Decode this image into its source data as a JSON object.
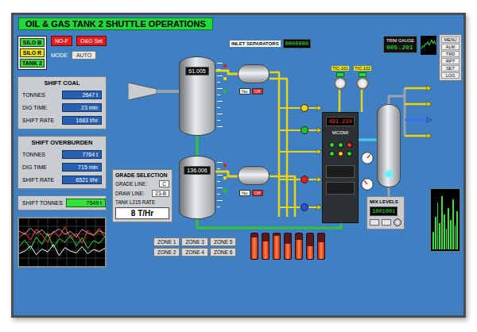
{
  "title": "OIL & GAS TANK 2 SHUTTLE OPERATIONS",
  "legend": [
    {
      "label": "SILO B",
      "color": "#39d839"
    },
    {
      "label": "SILO R",
      "color": "#f2e600"
    },
    {
      "label": "TANK 2",
      "color": "#39d839"
    }
  ],
  "buttons": [
    {
      "label": "NO-F"
    },
    {
      "label": "O&G Set"
    }
  ],
  "mode": {
    "label": "MODE",
    "value": "AUTO"
  },
  "panels": [
    {
      "title": "SHIFT COAL",
      "rows": [
        {
          "label": "TONNES",
          "value": "2647 t"
        },
        {
          "label": "DIG TIME",
          "value": "23 min"
        },
        {
          "label": "SHIFT RATE",
          "value": "1683 t/hr"
        }
      ]
    },
    {
      "title": "SHIFT OVERBURDEN",
      "rows": [
        {
          "label": "TONNES",
          "value": "7764 t"
        },
        {
          "label": "DIG TIME",
          "value": "715 min"
        },
        {
          "label": "SHIFT RATE",
          "value": "6521 t/hr"
        }
      ]
    }
  ],
  "shift_tonnes": {
    "label": "SHIFT TONNES",
    "value": "7549 t"
  },
  "trend": {
    "series": [
      {
        "color": "#ff3b3b",
        "values": [
          60,
          72,
          55,
          80,
          66,
          50,
          75,
          62,
          85,
          58,
          70,
          48,
          77,
          64,
          82,
          60
        ]
      },
      {
        "color": "#39e039",
        "values": [
          40,
          55,
          35,
          62,
          45,
          70,
          38,
          58,
          50,
          66,
          42,
          60,
          36,
          54,
          47,
          63
        ]
      },
      {
        "color": "#ffffff",
        "values": [
          25,
          30,
          42,
          22,
          35,
          28,
          45,
          20,
          38,
          30,
          26,
          40,
          24,
          34,
          29,
          37
        ]
      },
      {
        "color": "#f0a0a0",
        "values": [
          75,
          68,
          82,
          70,
          78,
          65,
          72,
          80,
          68,
          74,
          62,
          79,
          71,
          66,
          76,
          70
        ]
      }
    ]
  },
  "grade": {
    "title": "GRADE SELECTION",
    "rows": [
      {
        "label": "GRADE LINE:",
        "value": "C"
      },
      {
        "label": "DRAW LINE:",
        "value": "23-B"
      }
    ],
    "rate_label": "TANK L215 RATE",
    "rate": "8 T/Hr"
  },
  "zones": [
    "ZONE 1",
    "ZONE 2",
    "ZONE 3",
    "ZONE 4",
    "ZONE 5",
    "ZONE 6"
  ],
  "inlet": {
    "label": "INLET SEPARATORS",
    "display": "0000000"
  },
  "tanks": [
    {
      "reading": "61.005"
    },
    {
      "reading": "136.006"
    }
  ],
  "separators": [
    {
      "switches": [
        {
          "label": "No",
          "color": "#ffffff"
        },
        {
          "label": "Off",
          "color": "#e02020"
        }
      ]
    },
    {
      "switches": [
        {
          "label": "No",
          "color": "#ffffff"
        },
        {
          "label": "Off",
          "color": "#e02020"
        }
      ]
    }
  ],
  "valves": [
    {
      "color": "#f2d200"
    },
    {
      "color": "#22c322"
    },
    {
      "color": "#e02020"
    },
    {
      "color": "#2a4fe0"
    }
  ],
  "cabinet": {
    "readout": "491.234",
    "tag": "MCDMI",
    "lights": [
      {
        "color": "#33dd33"
      },
      {
        "color": "#33dd33"
      },
      {
        "color": "#ff3333"
      },
      {
        "color": "#33dd33"
      },
      {
        "color": "#ffcc00"
      },
      {
        "color": "#33dd33"
      }
    ]
  },
  "dials": [
    {
      "level": 0.65
    },
    {
      "level": 0.35
    }
  ],
  "instruments": [
    {
      "label": "TIC-101"
    },
    {
      "label": "TIC-102"
    }
  ],
  "outlets": [
    {
      "color": "#f2d200"
    },
    {
      "color": "#f2d200"
    },
    {
      "color": "#3a6cff"
    },
    {
      "color": "#f2d200"
    }
  ],
  "top_display": {
    "label": "TRIM GAUGE",
    "value": "005.201"
  },
  "sparkline": {
    "values": [
      30,
      45,
      40,
      60,
      55,
      70,
      50,
      65,
      80,
      60,
      75,
      55
    ]
  },
  "side_menu": [
    "MENU",
    "ALM",
    "TRD",
    "RPT",
    "SET",
    "LOG"
  ],
  "level_bars": [
    {
      "level": 0.85
    },
    {
      "level": 0.7
    },
    {
      "level": 0.9
    },
    {
      "level": 0.6
    },
    {
      "level": 0.75
    },
    {
      "level": 0.5
    },
    {
      "level": 0.65
    }
  ],
  "mix": {
    "label": "MIX LEVELS",
    "display": "1001001"
  },
  "spectrum": {
    "values": [
      30,
      55,
      80,
      45,
      90,
      60,
      35,
      70,
      50,
      85,
      40,
      65
    ]
  }
}
